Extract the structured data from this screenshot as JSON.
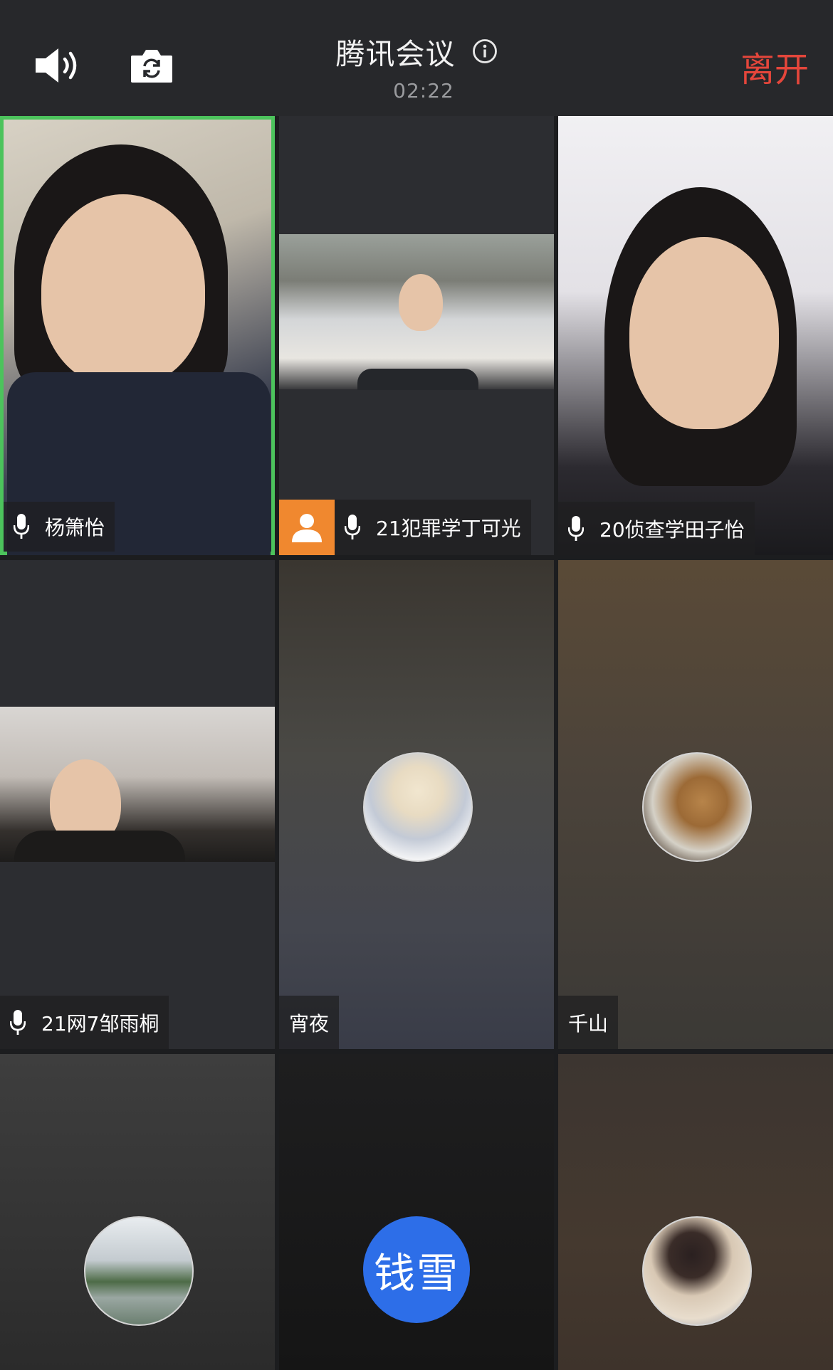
{
  "header": {
    "title": "腾讯会议",
    "timer": "02:22",
    "leave_label": "离开",
    "icons": [
      "speaker-icon",
      "camera-switch-icon",
      "info-icon"
    ]
  },
  "participants": [
    {
      "name": "杨箫怡",
      "mic": true,
      "video": true,
      "active_speaker": true
    },
    {
      "name": "21犯罪学丁可光",
      "mic": true,
      "video": true,
      "host": true
    },
    {
      "name": "20侦查学田子怡",
      "mic": true,
      "video": true
    },
    {
      "name": "21网7邹雨桐",
      "mic": true,
      "video": true
    },
    {
      "name": "宵夜",
      "mic": false,
      "video": false
    },
    {
      "name": "千山",
      "mic": false,
      "video": false
    },
    {
      "name": "",
      "mic": false,
      "video": false
    },
    {
      "name": "",
      "mic": false,
      "video": false,
      "initials": "钱雪"
    },
    {
      "name": "",
      "mic": false,
      "video": false
    }
  ],
  "colors": {
    "active_border": "#4cc35c",
    "leave": "#e4463b",
    "host_badge": "#f0882f",
    "initial_avatar": "#2d6ee8"
  }
}
